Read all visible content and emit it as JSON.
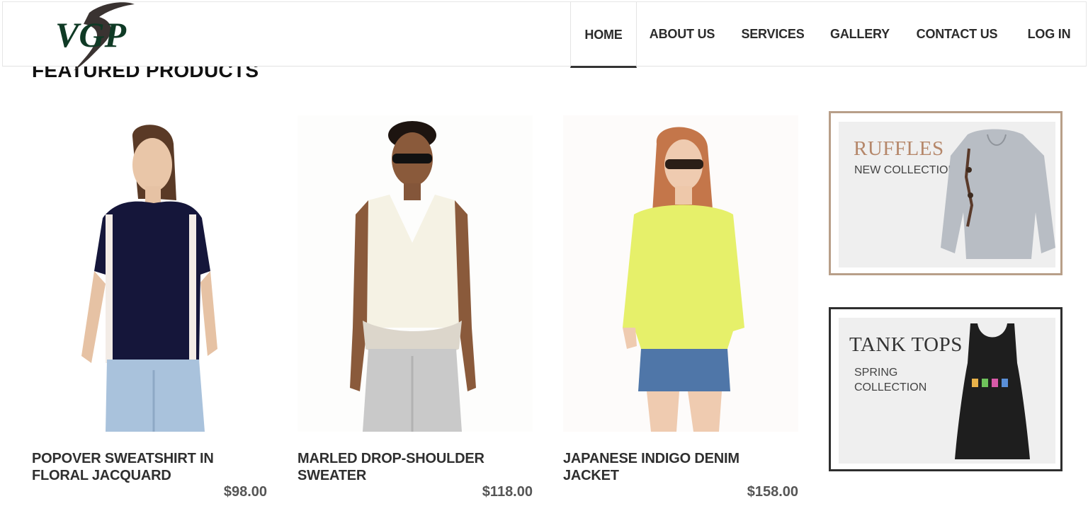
{
  "header": {
    "logo_text": "VGP",
    "nav": [
      {
        "label": "HOME",
        "active": true
      },
      {
        "label": "ABOUT US",
        "active": false
      },
      {
        "label": "SERVICES",
        "active": false
      },
      {
        "label": "GALLERY",
        "active": false
      },
      {
        "label": "CONTACT US",
        "active": false
      },
      {
        "label": "LOG IN",
        "active": false
      }
    ]
  },
  "main": {
    "section_title": "FEATURED PRODUCTS",
    "products": [
      {
        "name": "POPOVER SWEATSHIRT IN FLORAL JACQUARD",
        "price": "$98.00",
        "top_color": "#15163a",
        "bottom_color": "#a9c2dc"
      },
      {
        "name": "MARLED DROP-SHOULDER SWEATER",
        "price": "$118.00",
        "top_color": "#f5f2e4",
        "bottom_color": "#c9c9c9"
      },
      {
        "name": "JAPANESE INDIGO DENIM JACKET",
        "price": "$158.00",
        "top_color": "#e6f06a",
        "bottom_color": "#4f76a8"
      }
    ]
  },
  "sidebar": {
    "banners": [
      {
        "title": "RUFFLES",
        "subtitle_line1": "NEW COLLECTION",
        "subtitle_line2": "",
        "title_color": "#b5876a",
        "border_color": "#b89f89"
      },
      {
        "title": "TANK TOPS",
        "subtitle_line1": "SPRING",
        "subtitle_line2": "COLLECTION",
        "title_color": "#333333",
        "border_color": "#2e2e2e"
      }
    ]
  },
  "colors": {
    "nav_text": "#2b2b2b",
    "price": "#555555",
    "logo_green": "#0f3a25",
    "logo_swoosh": "#3a3331"
  }
}
